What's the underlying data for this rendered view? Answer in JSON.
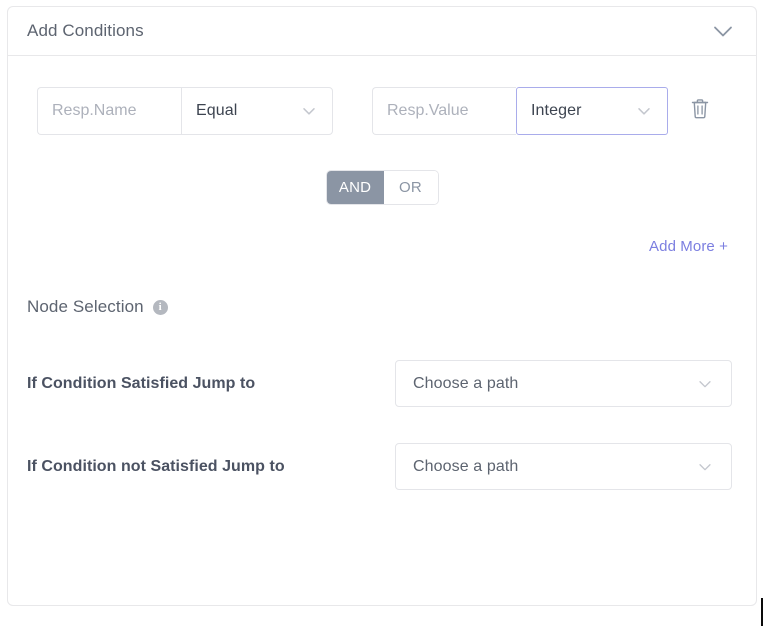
{
  "panel": {
    "header": {
      "title": "Add Conditions",
      "collapse_icon": "chevron-down-icon"
    }
  },
  "conditions": {
    "rows": [
      {
        "name_value": "",
        "name_placeholder": "Resp.Name",
        "operator": "Equal",
        "operator_icon": "chevron-down-icon",
        "value_value": "",
        "value_placeholder": "Resp.Value",
        "value_type": "Integer",
        "value_type_icon": "chevron-down-icon",
        "delete_icon": "trash-icon"
      }
    ],
    "logic_toggle": {
      "and_label": "AND",
      "or_label": "OR",
      "selected": "AND"
    },
    "add_more_label": "Add More +"
  },
  "node_selection": {
    "title": "Node Selection",
    "info_icon": "info-icon",
    "info_glyph": "i",
    "rows": [
      {
        "label": "If Condition Satisfied Jump to",
        "select_value": "Choose a path",
        "select_icon": "chevron-down-icon"
      },
      {
        "label": "If Condition not Satisfied Jump to",
        "select_value": "Choose a path",
        "select_icon": "chevron-down-icon"
      }
    ]
  },
  "colors": {
    "accent_link": "#7b7ee0",
    "toggle_active_bg": "#8b95a4",
    "focus_border": "#a9aceb",
    "border": "#e4e5e9",
    "text_primary": "#4b5262",
    "text_muted": "#5d6470",
    "placeholder": "#adb1bb"
  }
}
